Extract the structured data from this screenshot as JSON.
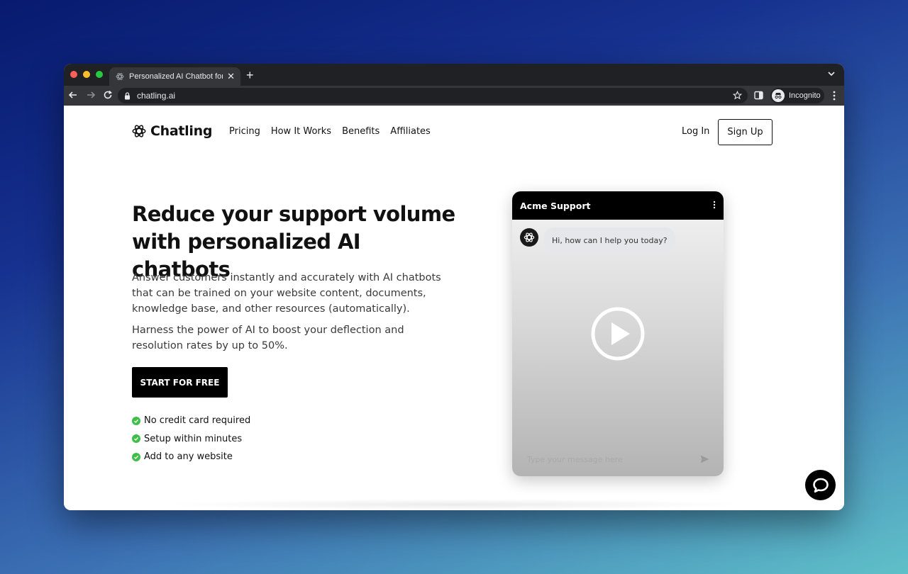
{
  "browser": {
    "tab_title": "Personalized AI Chatbot for Cu",
    "url": "chatling.ai",
    "profile_label": "Incognito",
    "traffic_colors": [
      "#ff5f57",
      "#febc2e",
      "#28c840"
    ]
  },
  "nav": {
    "brand": "Chatling",
    "links": [
      "Pricing",
      "How It Works",
      "Benefits",
      "Affiliates"
    ],
    "login": "Log In",
    "signup": "Sign Up"
  },
  "hero": {
    "title_line1": "Reduce your support volume",
    "title_line2": "with personalized AI chatbots",
    "paragraph1": "Answer customers instantly and accurately with AI chatbots that can be trained on your website content, documents, knowledge base, and other resources (automatically).",
    "paragraph2": "Harness the power of AI to boost your deflection and resolution rates by up to 50%.",
    "cta": "START FOR FREE",
    "checks": [
      "No credit card required",
      "Setup within minutes",
      "Add to any website"
    ]
  },
  "widget": {
    "title": "Acme Support",
    "greeting": "Hi, how can I help you today?",
    "input_placeholder": "Type your message here"
  },
  "icons": {
    "brand": "atom-logo-icon",
    "check": "check-circle-icon",
    "play": "play-icon",
    "send": "send-icon",
    "chat_launcher": "chat-bubble-icon"
  },
  "colors": {
    "accent": "#000000",
    "check_green": "#3fbf4a"
  }
}
